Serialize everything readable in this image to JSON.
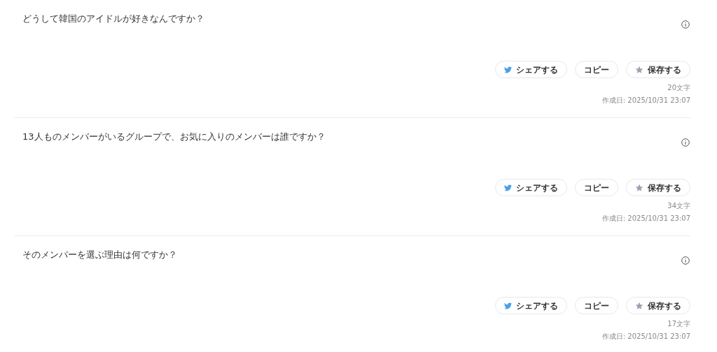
{
  "questions": [
    {
      "text": "どうして韓国のアイドルが好きなんですか？",
      "buttons": [
        {
          "kind": "share",
          "label": "シェアする"
        },
        {
          "kind": "copy",
          "label": "コピー"
        },
        {
          "kind": "save",
          "label": "保存する"
        }
      ],
      "count": "20文字",
      "created": "作成日: 2025/10/31 23:07"
    },
    {
      "text": "13人ものメンバーがいるグループで、お気に入りのメンバーは誰ですか？",
      "buttons": [
        {
          "kind": "share",
          "label": "シェアする"
        },
        {
          "kind": "copy",
          "label": "コピー"
        },
        {
          "kind": "save",
          "label": "保存する"
        }
      ],
      "count": "34文字",
      "created": "作成日: 2025/10/31 23:07"
    },
    {
      "text": "そのメンバーを選ぶ理由は何ですか？",
      "buttons": [
        {
          "kind": "share",
          "label": "シェアする"
        },
        {
          "kind": "copy",
          "label": "コピー"
        },
        {
          "kind": "save",
          "label": "保存する"
        }
      ],
      "count": "17文字",
      "created": "作成日: 2025/10/31 23:07"
    }
  ]
}
